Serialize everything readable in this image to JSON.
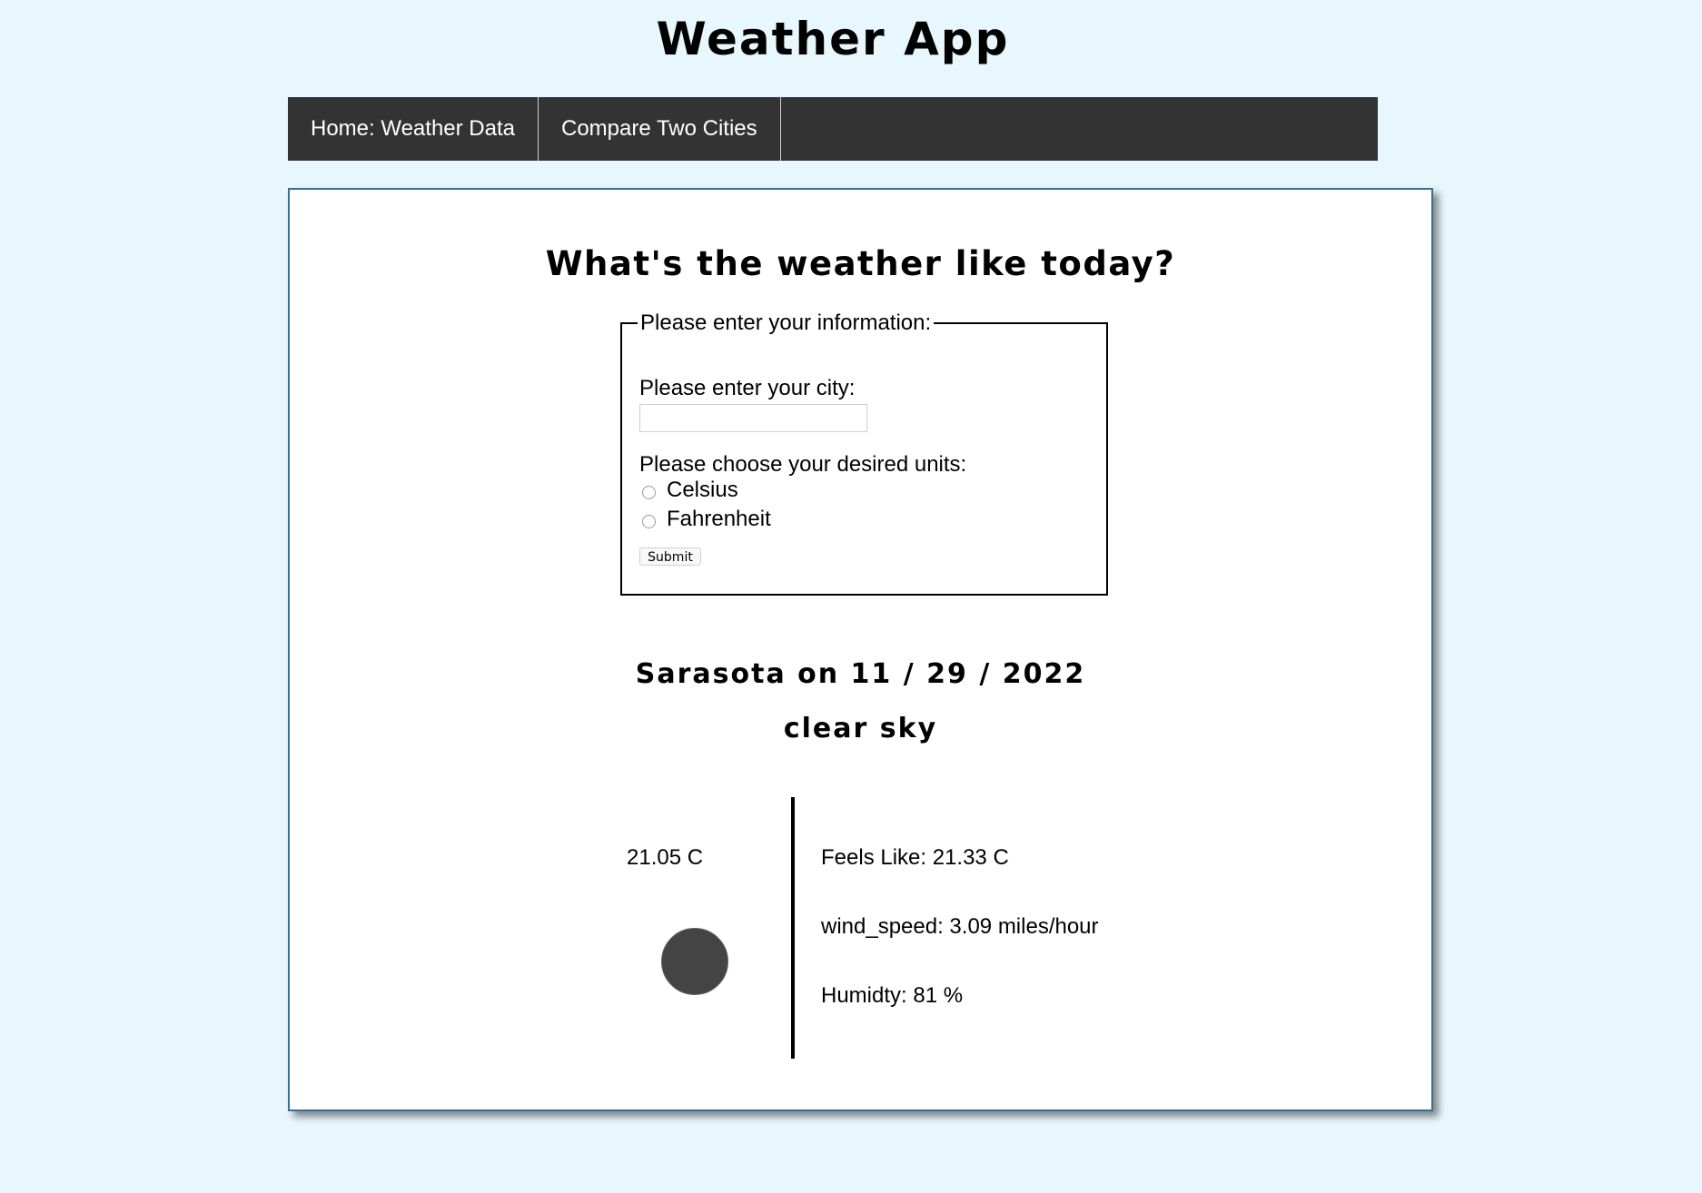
{
  "app": {
    "title": "Weather App"
  },
  "nav": {
    "items": [
      {
        "label": "Home: Weather Data"
      },
      {
        "label": "Compare Two Cities"
      }
    ]
  },
  "form": {
    "question": "What's the weather like today?",
    "legend": "Please enter your information:",
    "city_label": "Please enter your city:",
    "city_value": "",
    "city_placeholder": "",
    "units_label": "Please choose your desired units:",
    "units": [
      {
        "label": "Celsius",
        "checked": false
      },
      {
        "label": "Fahrenheit",
        "checked": false
      }
    ],
    "submit_label": "Submit"
  },
  "result": {
    "city_date": "Sarasota on 11 / 29 / 2022",
    "description": "clear sky",
    "temperature": "21.05 C",
    "feels_like": "Feels Like: 21.33 C",
    "wind_speed": "wind_speed: 3.09 miles/hour",
    "humidity": "Humidty: 81 %",
    "icon": "weather-condition-icon"
  },
  "colors": {
    "page_background": "#e8f7fd",
    "navbar": "#333333",
    "card_border": "#3b6f8f",
    "icon_fill": "#444444"
  }
}
